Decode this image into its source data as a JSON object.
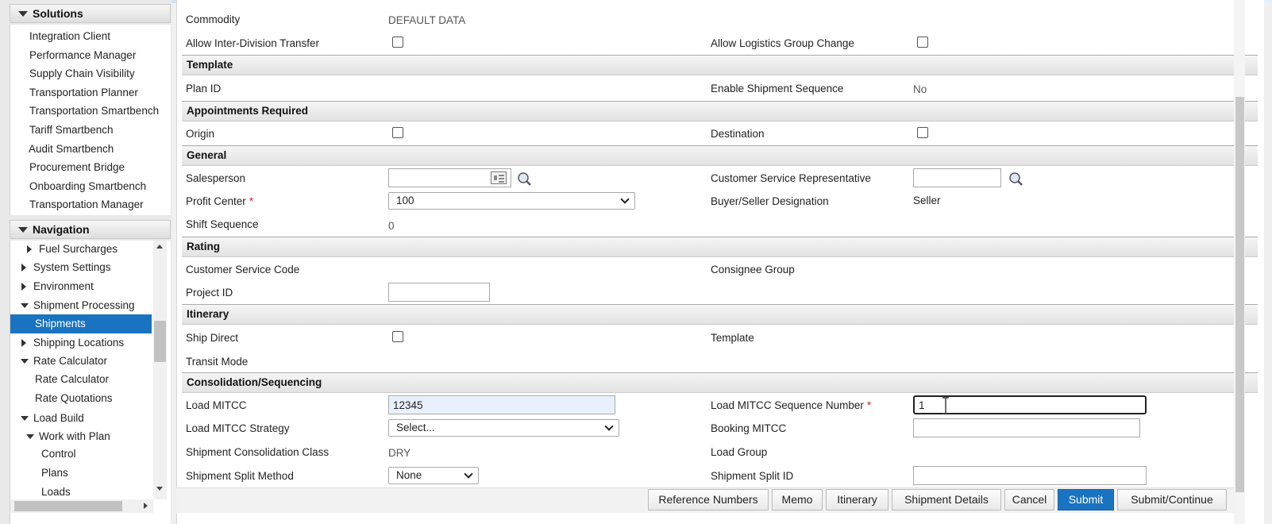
{
  "sidebar": {
    "solutions": {
      "title": "Solutions",
      "items": [
        "Integration Client",
        "Performance Manager",
        "Supply Chain Visibility",
        "Transportation Planner",
        "Transportation Smartbench",
        "Tariff Smartbench",
        "Audit Smartbench",
        "Procurement Bridge",
        "Onboarding Smartbench",
        "Transportation Manager"
      ]
    },
    "navigation": {
      "title": "Navigation",
      "items": [
        "Fuel Surcharges",
        "System Settings",
        "Environment",
        "Shipment Processing",
        "Shipments",
        "Shipping Locations",
        "Rate Calculator",
        "Rate Calculator",
        "Rate Quotations",
        "Load Build",
        "Work with Plan",
        "Control",
        "Plans",
        "Loads"
      ],
      "selected": "Shipments"
    }
  },
  "form": {
    "commodity_label": "Commodity",
    "commodity_value": "DEFAULT DATA",
    "allow_inter_division_label": "Allow Inter-Division Transfer",
    "allow_logistics_label": "Allow Logistics Group Change",
    "sections": {
      "template": "Template",
      "appointments": "Appointments Required",
      "general": "General",
      "rating": "Rating",
      "itinerary": "Itinerary",
      "consolidation": "Consolidation/Sequencing"
    },
    "plan_id_label": "Plan ID",
    "enable_seq_label": "Enable Shipment Sequence",
    "enable_seq_value": "No",
    "origin_label": "Origin",
    "destination_label": "Destination",
    "salesperson_label": "Salesperson",
    "salesperson_value": "",
    "csr_label": "Customer Service Representative",
    "csr_value": "",
    "profit_center_label": "Profit Center",
    "profit_center_value": "100",
    "buyer_seller_label": "Buyer/Seller Designation",
    "buyer_seller_value": "Seller",
    "shift_seq_label": "Shift Sequence",
    "shift_seq_value": "0",
    "cs_code_label": "Customer Service Code",
    "consignee_group_label": "Consignee Group",
    "project_id_label": "Project ID",
    "project_id_value": "",
    "ship_direct_label": "Ship Direct",
    "itin_template_label": "Template",
    "transit_mode_label": "Transit Mode",
    "load_mitcc_label": "Load MITCC",
    "load_mitcc_value": "12345",
    "load_mitcc_seq_label": "Load MITCC Sequence Number",
    "load_mitcc_seq_value": "1",
    "load_mitcc_strategy_label": "Load MITCC Strategy",
    "load_mitcc_strategy_value": "Select...",
    "booking_mitcc_label": "Booking MITCC",
    "booking_mitcc_value": "",
    "consolidation_class_label": "Shipment Consolidation Class",
    "consolidation_class_value": "DRY",
    "load_group_label": "Load Group",
    "split_method_label": "Shipment Split Method",
    "split_method_value": "None",
    "split_id_label": "Shipment Split ID",
    "split_id_value": "",
    "required_mark": "*"
  },
  "buttons": {
    "reference_numbers": "Reference Numbers",
    "memo": "Memo",
    "itinerary": "Itinerary",
    "shipment_details": "Shipment Details",
    "cancel": "Cancel",
    "submit": "Submit",
    "submit_continue": "Submit/Continue"
  },
  "colors": {
    "accent": "#1a73c0",
    "required": "#dd2222"
  }
}
